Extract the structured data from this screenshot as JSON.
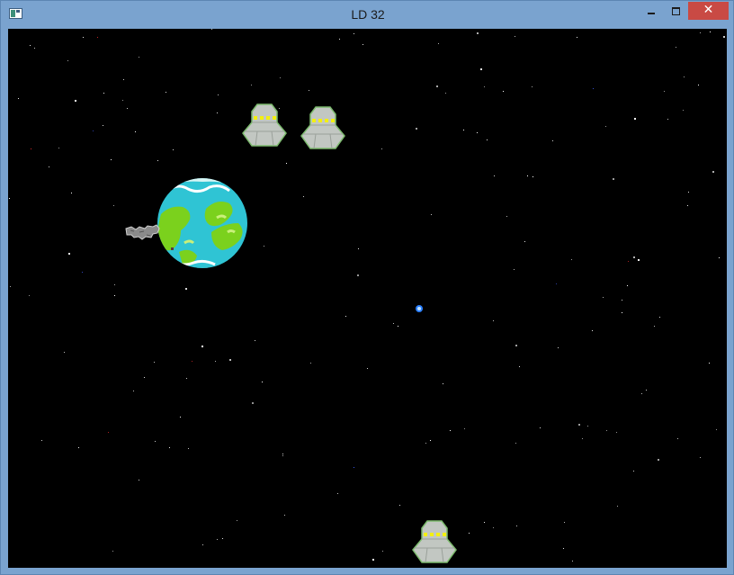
{
  "window": {
    "title": "LD 32",
    "icons": {
      "app": "app-window-icon",
      "minimize": "minimize-icon",
      "maximize": "maximize-icon",
      "close": "close-icon"
    },
    "close_glyph": "✕"
  },
  "scene": {
    "background_color": "#000000",
    "objects": [
      {
        "name": "planet",
        "type": "earth-like planet"
      },
      {
        "name": "asteroid-debris",
        "type": "grey rock cluster"
      },
      {
        "name": "player-orb",
        "type": "small blue orb",
        "color": "#2a7fff"
      },
      {
        "name": "alien-ship",
        "type": "grey ufo with yellow lights"
      },
      {
        "name": "alien-ship",
        "type": "grey ufo with yellow lights"
      },
      {
        "name": "alien-ship",
        "type": "grey ufo with yellow lights"
      }
    ],
    "colors": {
      "ship_body": "#c2c7c2",
      "ship_outline": "#7dbb6e",
      "ship_lights": "#f3f00f",
      "planet_ocean": "#2fc4d4",
      "planet_land": "#7bd11d",
      "planet_ice": "#d6f5f4"
    }
  }
}
